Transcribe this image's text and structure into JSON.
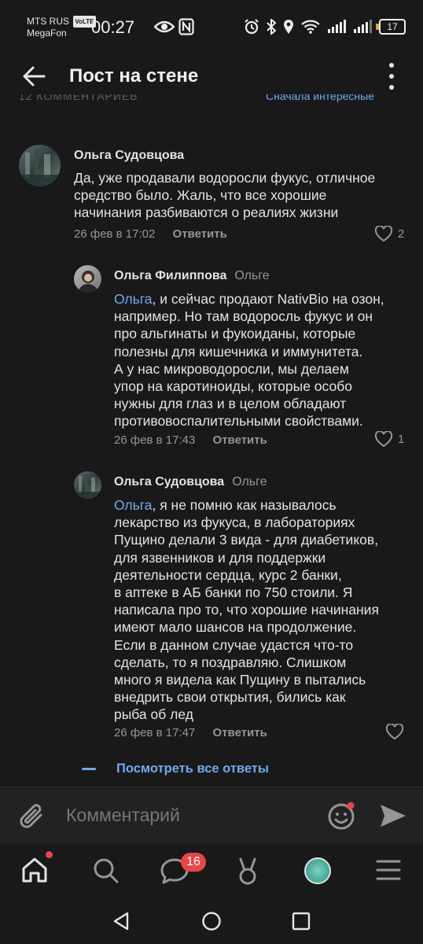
{
  "status_bar": {
    "carrier": "MTS RUS",
    "volte": "VoLTE",
    "carrier2": "MegaFon",
    "time": "00:27",
    "battery": "17"
  },
  "header": {
    "title": "Пост на стене"
  },
  "cut_row": {
    "left": "12 КОММЕНТАРИЕВ",
    "right": "Сначала интересные"
  },
  "comments": [
    {
      "author": "Ольга Судовцова",
      "reply_to": "",
      "mention": "",
      "text_lines": [
        "Да, уже продавали водоросли фукус, отличное",
        "средство было. Жаль, что все хорошие",
        "начинания разбиваются о реалиях жизни"
      ],
      "date": "26 фев в 17:02",
      "answer": "Ответить",
      "likes": "2"
    },
    {
      "author": "Ольга Филиппова",
      "reply_to": "Ольге",
      "mention": "Ольга",
      "first_rest": ", и сейчас продают NativBio на озон,",
      "text_lines": [
        "например. Но там водоросль фукус и он",
        "про альгинаты и фукоиданы, которые",
        "полезны для кишечника и иммунитета.",
        "А у нас микроводоросли, мы делаем",
        "упор на каротиноиды, которые особо",
        "нужны для глаз и в целом обладают",
        "противовоспалительными свойствами."
      ],
      "date": "26 фев в 17:43",
      "answer": "Ответить",
      "likes": "1"
    },
    {
      "author": "Ольга Судовцова",
      "reply_to": "Ольге",
      "mention": "Ольга",
      "first_rest": ", я не помню как называлось",
      "text_lines": [
        "лекарство из фукуса, в лабораториях",
        "Пущино делали 3 вида - для диабетиков,",
        "для язвенников и для поддержки",
        "деятельности сердца, курс 2 банки,",
        "в аптеке в АБ банки по 750 стоили. Я",
        "написала про то, что хорошие начинания",
        "имеют мало шансов на продолжение.",
        "Если в данном случае удастся что-то",
        "сделать, то я поздравляю. Слишком",
        "много я видела как Пущину в пытались",
        "внедрить свои открытия, бились как",
        "рыба об лед"
      ],
      "date": "26 фев в 17:47",
      "answer": "Ответить",
      "likes": ""
    }
  ],
  "show_all": "Посмотреть все ответы",
  "input": {
    "placeholder": "Комментарий"
  },
  "tabbar": {
    "messages_badge": "16"
  },
  "colors": {
    "accent": "#71aaeb",
    "badge": "#e64646",
    "background": "#19191a"
  }
}
